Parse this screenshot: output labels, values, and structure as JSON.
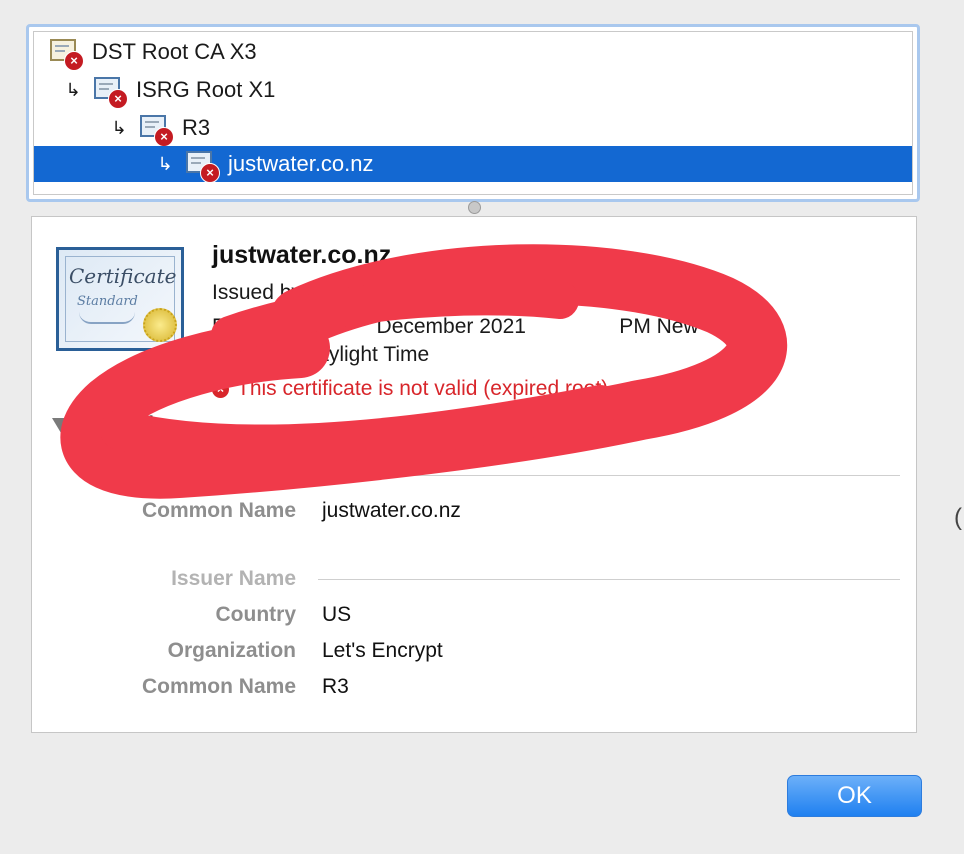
{
  "chain": [
    {
      "label": "DST Root CA X3",
      "icon": "certificate-root-icon"
    },
    {
      "label": "ISRG Root X1",
      "icon": "certificate-icon"
    },
    {
      "label": "R3",
      "icon": "certificate-icon"
    },
    {
      "label": "justwater.co.nz",
      "icon": "certificate-icon",
      "selected": true
    }
  ],
  "arrow_glyph": "↳",
  "certificate": {
    "image_title": "Certificate",
    "image_subtitle": "Standard",
    "title": "justwater.co.nz",
    "issued_by": "Issued by: R3",
    "expires": "Ex                        December 2021                PM New",
    "expires_line2": "Daylight Time",
    "status": "This certificate is not valid (expired root)"
  },
  "details": {
    "heading": "etails",
    "subject_common_name_label": "Common Name",
    "subject_common_name": "justwater.co.nz",
    "issuer_section_label": "Issuer Name",
    "country_label": "Country",
    "country": "US",
    "organization_label": "Organization",
    "organization": "Let's Encrypt",
    "issuer_common_name_label": "Common Name",
    "issuer_common_name": "R3"
  },
  "ok_label": "OK",
  "edge_glyph": "(",
  "colors": {
    "selection": "#1368d2",
    "error_red": "#d8262b",
    "scribble_red": "#f03a4a",
    "button_blue": "#1f80f0"
  }
}
